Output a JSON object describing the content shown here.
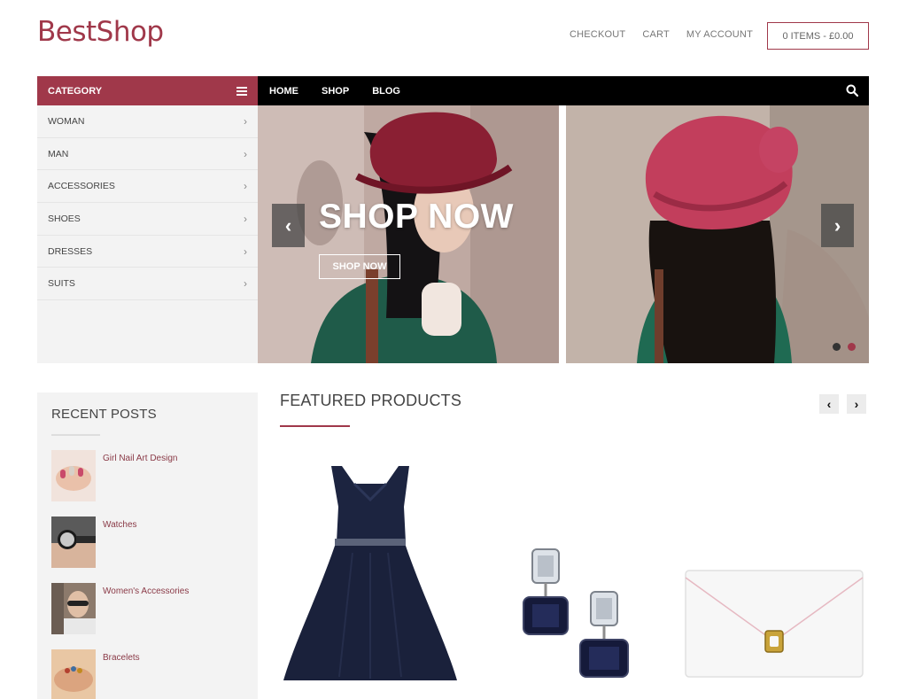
{
  "header": {
    "logo": "BestShop",
    "links": [
      "CHECKOUT",
      "CART",
      "MY ACCOUNT"
    ],
    "cart_summary": "0 ITEMS - £0.00"
  },
  "category": {
    "title": "CATEGORY",
    "items": [
      "WOMAN",
      "MAN",
      "ACCESSORIES",
      "SHOES",
      "DRESSES",
      "SUITS"
    ]
  },
  "nav": {
    "items": [
      "HOME",
      "SHOP",
      "BLOG"
    ],
    "search_icon": "search-icon"
  },
  "banner": {
    "title": "SHOP NOW",
    "button_label": "SHOP NOW",
    "prev_arrow": "‹",
    "next_arrow": "›",
    "slide_count": 2,
    "active_slide": 2
  },
  "recent_posts": {
    "title": "RECENT POSTS",
    "posts": [
      "Girl Nail Art Design",
      "Watches",
      "Women's Accessories",
      "Bracelets"
    ]
  },
  "featured": {
    "title": "FEATURED PRODUCTS",
    "prev_arrow": "‹",
    "next_arrow": "›"
  },
  "colors": {
    "accent": "#a0384a",
    "nav_bg": "#000000",
    "panel_bg": "#f3f3f3"
  }
}
